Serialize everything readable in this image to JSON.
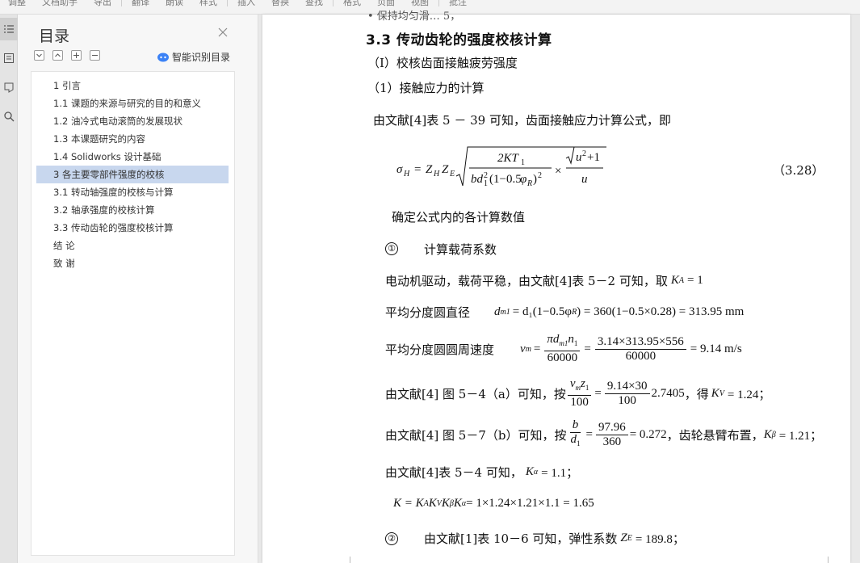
{
  "toolbar": {
    "items": [
      "调整",
      "文档助手",
      "导出",
      "翻译",
      "朗读",
      "样式",
      "插入",
      "替换",
      "查找",
      "格式",
      "页面",
      "视图",
      "批注"
    ]
  },
  "toc": {
    "title": "目录",
    "smart_label": "智能识别目录",
    "items": [
      "1 引言",
      "1.1  课题的来源与研究的目的和意义",
      "1.2  油冷式电动滚筒的发展现状",
      "1.3  本课题研究的内容",
      "1.4 Solidworks 设计基础",
      "3 各主要零部件强度的校核",
      "3.1  转动轴强度的校核与计算",
      "3.2  轴承强度的校核计算",
      "3.3  传动齿轮的强度校核计算",
      "结      论",
      "致      谢"
    ],
    "selected_index": 5
  },
  "doc": {
    "top_fragment": "• 保持均匀滑… 5，",
    "heading": "3.3  传动齿轮的强度校核计算",
    "sub1": "（Ⅰ）校核齿面接触疲劳强度",
    "sub2": "（1）接触应力的计算",
    "p1": "由文献[4]表 5 － 39 可知，齿面接触应力计算公式，即",
    "eq_number": "（3.28）",
    "p2": "确定公式内的各计算数值",
    "c1": "①",
    "p3": "计算载荷系数",
    "p4_text": "电动机驱动，载荷平稳，由文献[4]表 5－2 可知，取",
    "p4_math": "K",
    "p4_sub": "A",
    "p4_val": "= 1",
    "p5_label": "平均分度圆直径",
    "p5_math": "d",
    "p5_sub": "m1",
    "p5_expr": "= d₁(1−0.5φ",
    "p5_sub2": "R",
    "p5_rest": ") = 360(1−0.5×0.28) = 313.95 mm",
    "p6_label": "平均分度圆圆周速度",
    "p6_lhs": "v",
    "p6_lhs_sub": "m",
    "p6_f1_num": "πd",
    "p6_f1_num_sub": "m1",
    "p6_f1_num_tail": "n",
    "p6_f1_num_tail_sub": "1",
    "p6_f1_den": "60000",
    "p6_f2_num": "3.14×313.95×556",
    "p6_f2_den": "60000",
    "p6_result": "= 9.14 m/s",
    "p7_text": "由文献[4] 图 5－4（a）可知，按",
    "p7_f1_num": "v",
    "p7_f1_num_sub": "m",
    "p7_f1_num_tail": "z",
    "p7_f1_num_tail_sub": "1",
    "p7_f1_den": "100",
    "p7_f2_num": "9.14×30",
    "p7_f2_den": "100",
    "p7_mid": "2.7405",
    "p7_tail_text": "，得",
    "p7_math": "K",
    "p7_sub": "V",
    "p7_val": "= 1.24；",
    "p8_text": "由文献[4] 图 5－7（b）可知，按",
    "p8_f1_num": "b",
    "p8_f1_den": "d",
    "p8_f1_den_sub": "1",
    "p8_f2_num": "97.96",
    "p8_f2_den": "360",
    "p8_mid": "= 0.272",
    "p8_tail_text": "，齿轮悬臂布置，",
    "p8_math": "K",
    "p8_sub": "β",
    "p8_val": "= 1.21；",
    "p9_text": "由文献[4]表 5－4 可知，",
    "p9_math": "K",
    "p9_sub": "α",
    "p9_val": "= 1.1；",
    "p10": "K = K",
    "p10_a": "A",
    "p10_b": "K",
    "p10_bs": "V",
    "p10_c": "K",
    "p10_cs": "β",
    "p10_d": "K",
    "p10_ds": "α",
    "p10_val": " = 1×1.24×1.21×1.1 = 1.65",
    "c2": "②",
    "p11_text": "由文献[1]表 10－6 可知，弹性系数",
    "p11_math": "Z",
    "p11_sub": "E",
    "p11_val": "= 189.8；"
  }
}
